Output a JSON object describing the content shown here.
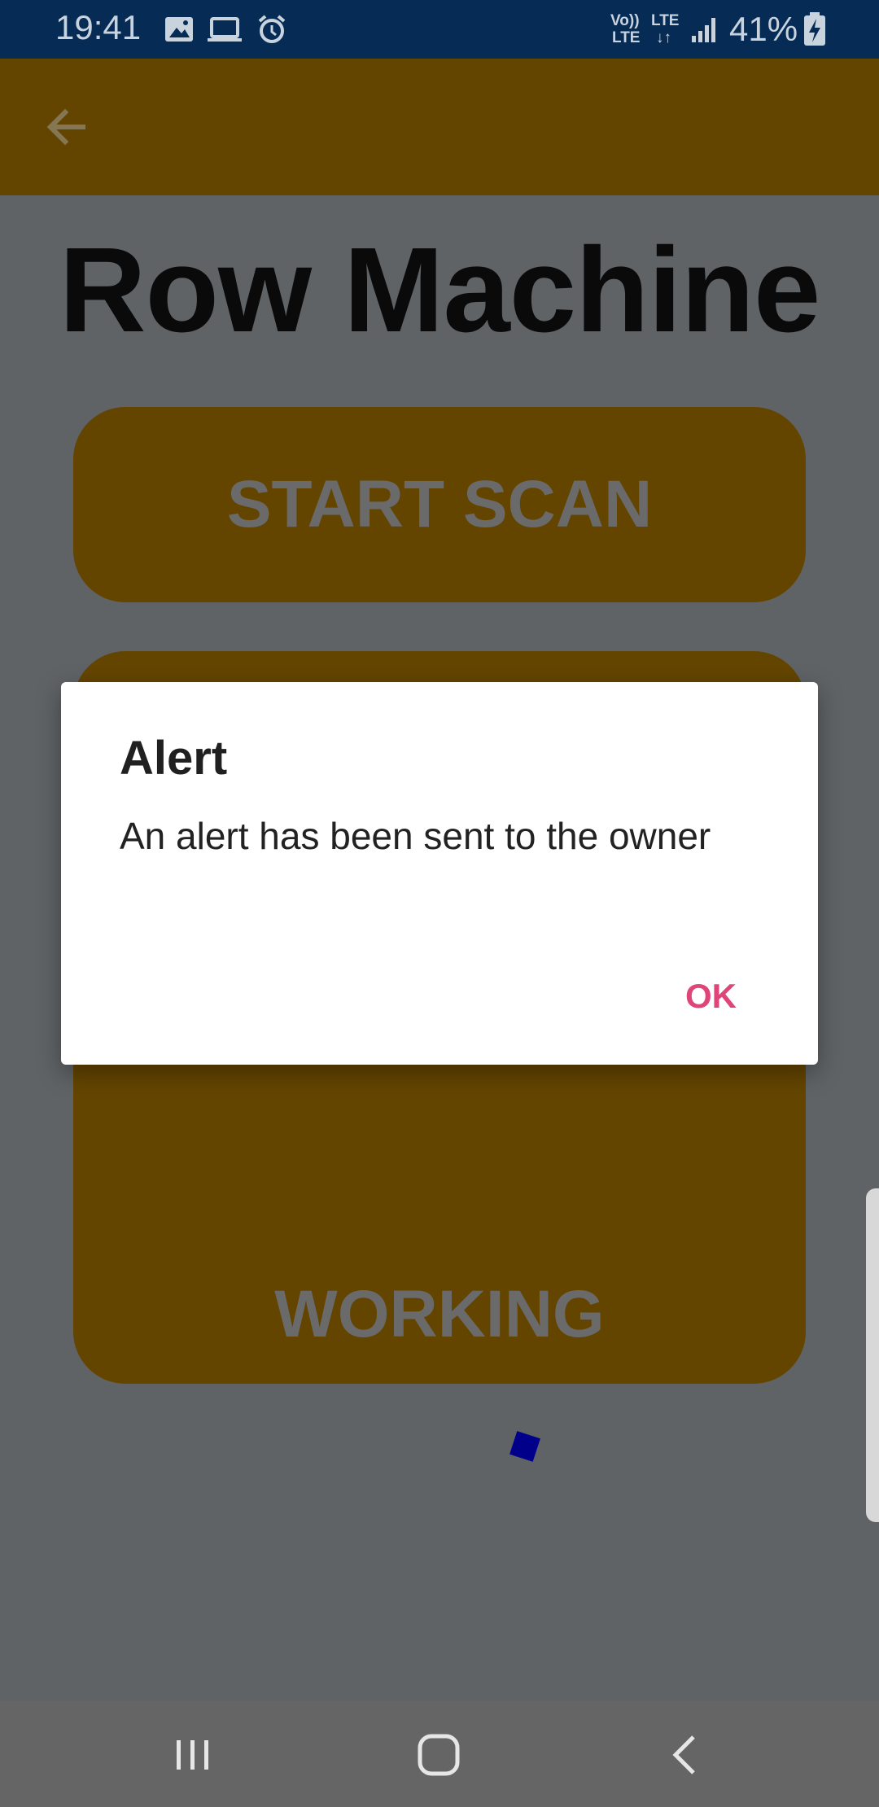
{
  "status_bar": {
    "time": "19:41",
    "volte_top": "Vo))",
    "volte_bottom": "LTE",
    "lte_top": "LTE",
    "lte_arrows": "↓↑",
    "battery": "41%",
    "icons": [
      "image-icon",
      "laptop-icon",
      "alarm-icon",
      "signal-icon",
      "battery-charging-icon"
    ]
  },
  "app_bar": {
    "back_icon": "arrow-left-icon"
  },
  "page": {
    "title": "Row Machine",
    "start_scan_label": "START SCAN",
    "second_button_label": "WORKING"
  },
  "dialog": {
    "title": "Alert",
    "message": "An alert has been sent to the owner",
    "ok_label": "OK"
  },
  "nav_bar": {
    "icons": [
      "recent-apps-icon",
      "home-icon",
      "back-icon"
    ]
  },
  "colors": {
    "status_bar": "#062c55",
    "app_bar": "#644500",
    "button": "#644500",
    "scrim_background": "#5f6366",
    "dialog_accent": "#e0457a",
    "spinner": "#00008b"
  }
}
